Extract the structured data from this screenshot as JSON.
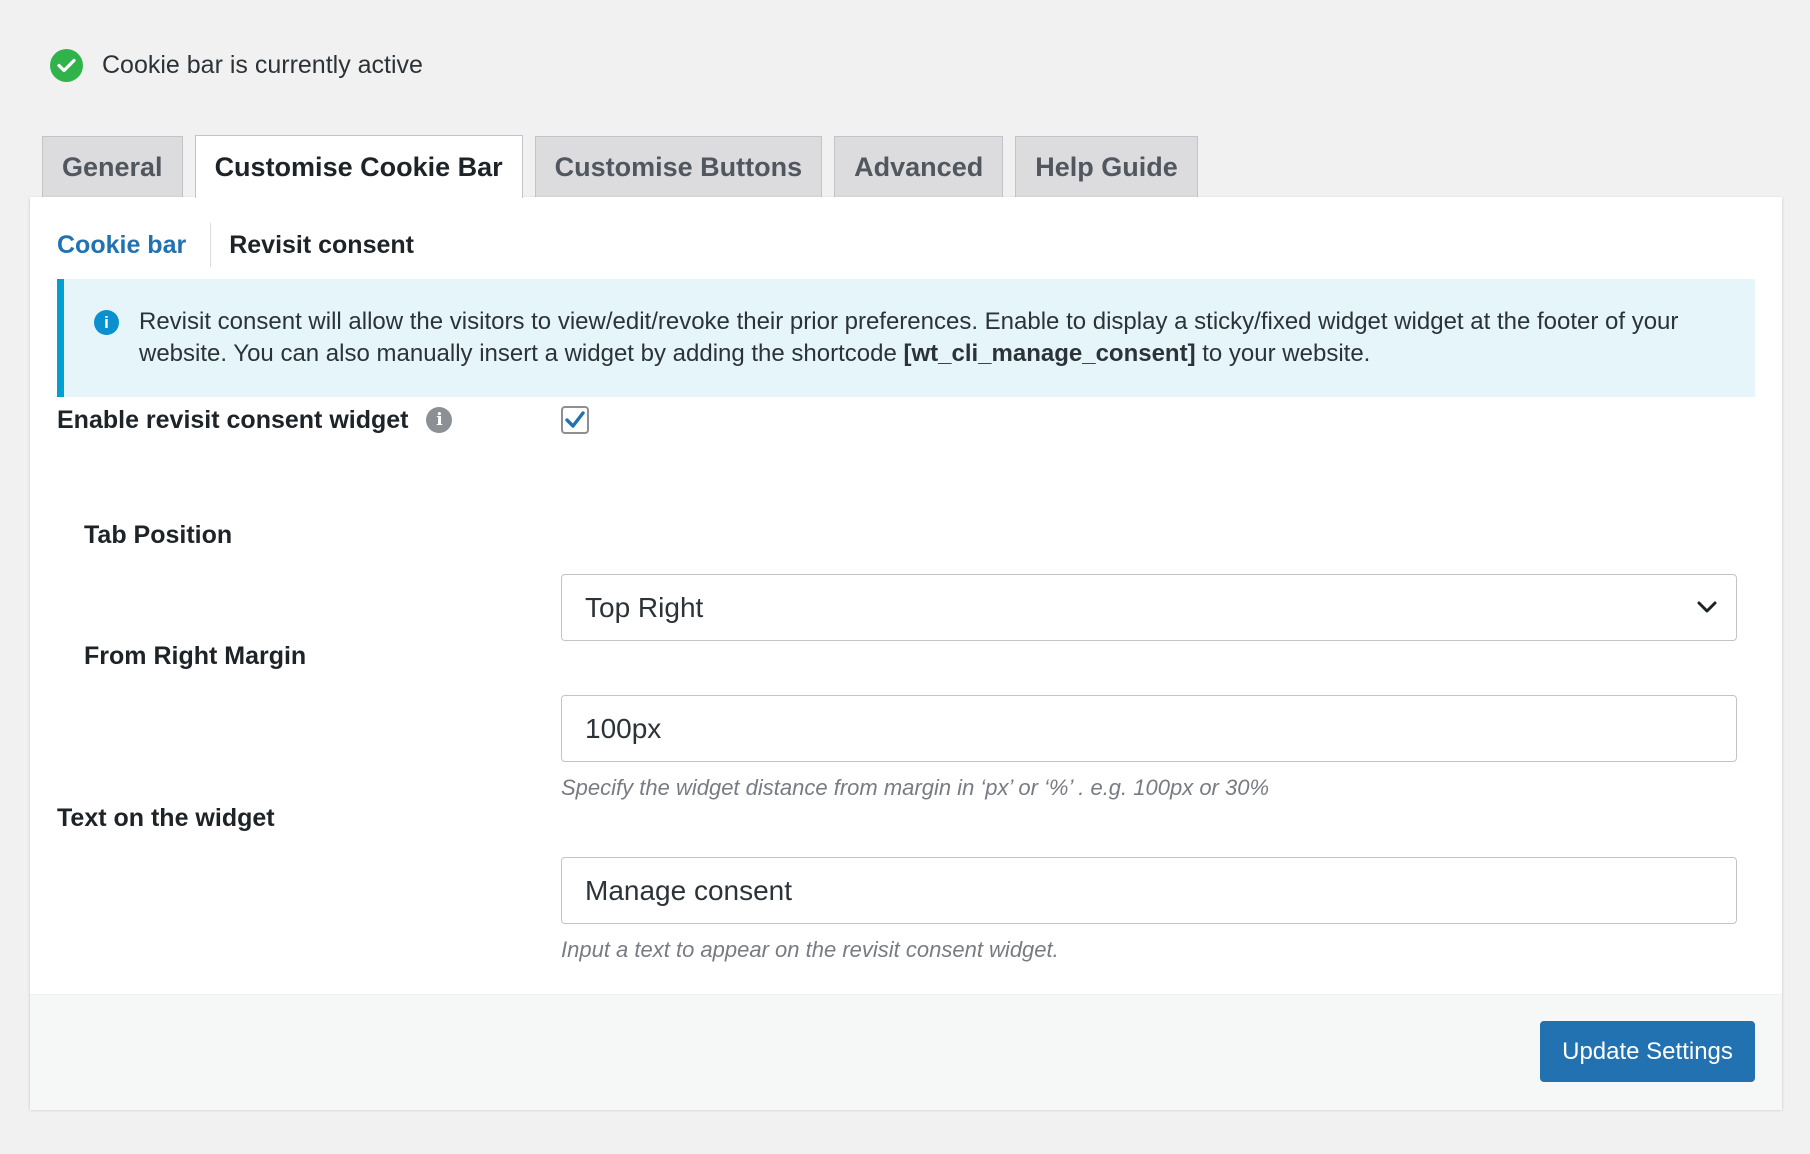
{
  "status": {
    "text": "Cookie bar is currently active",
    "icon": "check-circle-icon",
    "color": "#2fb34a"
  },
  "tabs": [
    {
      "label": "General",
      "active": false
    },
    {
      "label": "Customise Cookie Bar",
      "active": true
    },
    {
      "label": "Customise Buttons",
      "active": false
    },
    {
      "label": "Advanced",
      "active": false
    },
    {
      "label": "Help Guide",
      "active": false
    }
  ],
  "subtabs": {
    "cookie_bar": "Cookie bar",
    "revisit_consent": "Revisit consent"
  },
  "notice": {
    "icon": "info-icon",
    "text_before": "Revisit consent will allow the visitors to view/edit/revoke their prior preferences. Enable to display a sticky/fixed widget widget at the footer of your website. You can also manually insert a widget by adding the shortcode ",
    "shortcode": "[wt_cli_manage_consent]",
    "text_after": " to your website."
  },
  "form": {
    "enable_widget": {
      "label": "Enable revisit consent widget",
      "help_icon": "info-icon",
      "help_glyph": "i",
      "checked": true
    },
    "tab_position": {
      "label": "Tab Position",
      "value": "Top Right",
      "icon": "chevron-down-icon"
    },
    "right_margin": {
      "label": "From Right Margin",
      "value": "100px",
      "hint": "Specify the widget distance from margin in ‘px’ or ‘%’ . e.g. 100px or 30%"
    },
    "widget_text": {
      "label": "Text on the widget",
      "value": "Manage consent",
      "hint": "Input a text to appear on the revisit consent widget."
    }
  },
  "footer": {
    "update_button": "Update Settings"
  },
  "colors": {
    "accent": "#2271b1",
    "notice_bg": "#e5f5fa",
    "notice_border": "#00a0d2"
  }
}
